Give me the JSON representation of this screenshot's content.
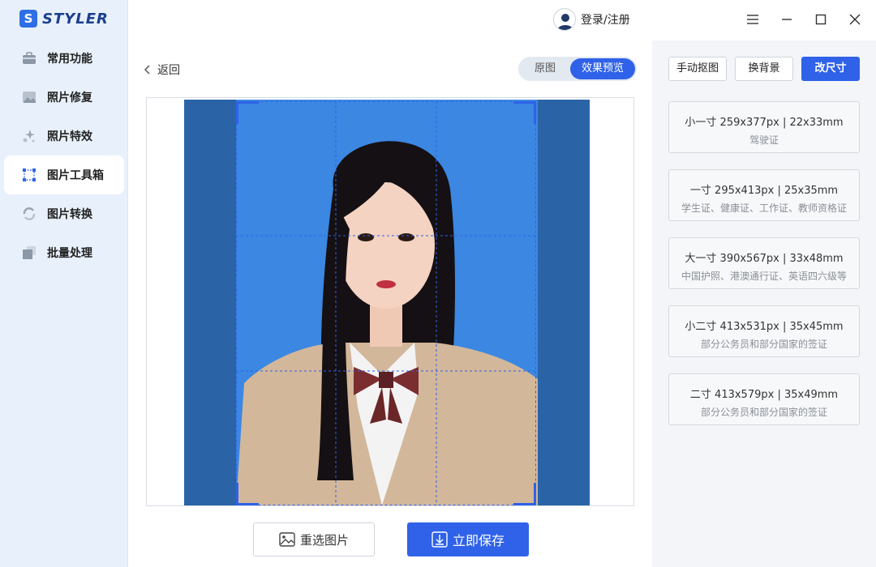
{
  "app": {
    "logo_text": "STYLER",
    "logo_letter": "S"
  },
  "colors": {
    "accent": "#2f62e8",
    "sidebar_bg": "#e8f1fb",
    "photo_bg": "#3b87e2",
    "photo_outer": "#2a64a6"
  },
  "sidebar": {
    "items": [
      {
        "label": "常用功能",
        "icon": "toolbox-icon"
      },
      {
        "label": "照片修复",
        "icon": "photo-repair-icon"
      },
      {
        "label": "照片特效",
        "icon": "sparkle-icon"
      },
      {
        "label": "图片工具箱",
        "icon": "crop-frame-icon",
        "active": true
      },
      {
        "label": "图片转换",
        "icon": "convert-icon"
      },
      {
        "label": "批量处理",
        "icon": "batch-icon"
      }
    ]
  },
  "header": {
    "login_label": "登录/注册"
  },
  "main": {
    "back_label": "返回",
    "toggle": {
      "original": "原图",
      "preview": "效果预览"
    },
    "reselect_label": "重选图片",
    "save_label": "立即保存"
  },
  "right_panel": {
    "tools": {
      "manual_cutout": "手动抠图",
      "change_bg": "换背景",
      "resize": "改尺寸"
    },
    "sizes": [
      {
        "title": "小一寸 259x377px | 22x33mm",
        "desc": "驾驶证"
      },
      {
        "title": "一寸 295x413px | 25x35mm",
        "desc": "学生证、健康证、工作证、教师资格证"
      },
      {
        "title": "大一寸 390x567px | 33x48mm",
        "desc": "中国护照、港澳通行证、英语四六级等"
      },
      {
        "title": "小二寸 413x531px | 35x45mm",
        "desc": "部分公务员和部分国家的签证"
      },
      {
        "title": "二寸 413x579px | 35x49mm",
        "desc": "部分公务员和部分国家的签证"
      }
    ]
  }
}
